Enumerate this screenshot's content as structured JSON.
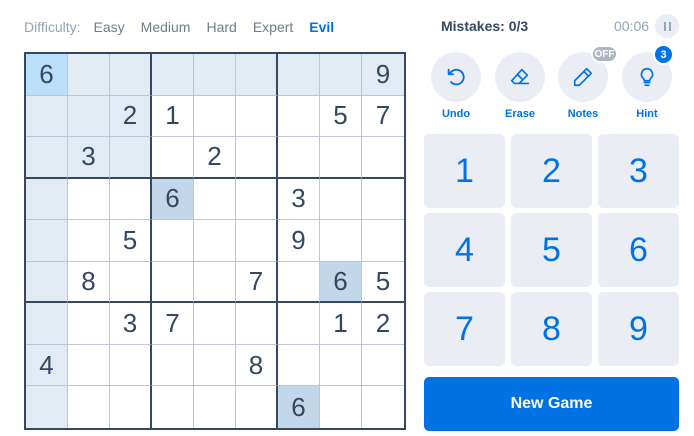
{
  "difficulty": {
    "label": "Difficulty:",
    "options": [
      "Easy",
      "Medium",
      "Hard",
      "Expert",
      "Evil"
    ],
    "active": "Evil"
  },
  "status": {
    "mistakes": "Mistakes: 0/3",
    "timer": "00:06"
  },
  "board": [
    [
      "6",
      "",
      "",
      "",
      "",
      "",
      "",
      "",
      "9"
    ],
    [
      "",
      "",
      "2",
      "1",
      "",
      "",
      "",
      "5",
      "7"
    ],
    [
      "",
      "3",
      "",
      "",
      "2",
      "",
      "",
      "",
      ""
    ],
    [
      "",
      "",
      "",
      "6",
      "",
      "",
      "3",
      "",
      ""
    ],
    [
      "",
      "",
      "5",
      "",
      "",
      "",
      "9",
      "",
      ""
    ],
    [
      "",
      "8",
      "",
      "",
      "",
      "7",
      "",
      "6",
      "5"
    ],
    [
      "",
      "",
      "3",
      "7",
      "",
      "",
      "",
      "1",
      "2"
    ],
    [
      "4",
      "",
      "",
      "",
      "",
      "8",
      "",
      "",
      ""
    ],
    [
      "",
      "",
      "",
      "",
      "",
      "",
      "6",
      "",
      ""
    ]
  ],
  "selected_cell": [
    0,
    0
  ],
  "tools": {
    "undo": {
      "label": "Undo",
      "icon": "undo-icon"
    },
    "erase": {
      "label": "Erase",
      "icon": "eraser-icon"
    },
    "notes": {
      "label": "Notes",
      "icon": "pencil-icon",
      "badge": "OFF"
    },
    "hint": {
      "label": "Hint",
      "icon": "lightbulb-icon",
      "badge": "3"
    }
  },
  "numpad": [
    "1",
    "2",
    "3",
    "4",
    "5",
    "6",
    "7",
    "8",
    "9"
  ],
  "new_game_label": "New Game",
  "colors": {
    "accent": "#0072e3",
    "text": "#344861",
    "highlight": "#e2ebf3",
    "same_number": "#c3d7ea",
    "selected": "#bbdefb"
  }
}
